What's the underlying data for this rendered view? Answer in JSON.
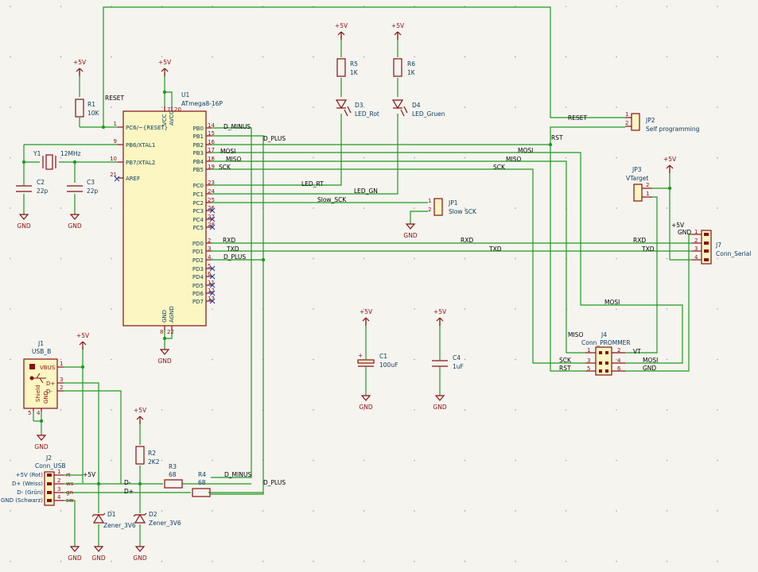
{
  "ic": {
    "ref": "U1",
    "value": "ATmega8-16P",
    "left_pins": [
      {
        "num": "1",
        "name": "PC6/~{RESET}"
      },
      {
        "num": "9",
        "name": "PB6/XTAL1"
      },
      {
        "num": "10",
        "name": "PB7/XTAL2"
      },
      {
        "num": "21",
        "name": "AREF"
      }
    ],
    "top_pins": [
      {
        "num": "7",
        "name": "VCC"
      },
      {
        "num": "20",
        "name": "AVCC"
      }
    ],
    "bottom_pins": [
      {
        "num": "8",
        "name": "GND"
      },
      {
        "num": "22",
        "name": "AGND"
      }
    ],
    "right_pins": [
      {
        "num": "14",
        "name": "PB0"
      },
      {
        "num": "15",
        "name": "PB1"
      },
      {
        "num": "16",
        "name": "PB2"
      },
      {
        "num": "17",
        "name": "PB3"
      },
      {
        "num": "18",
        "name": "PB4"
      },
      {
        "num": "19",
        "name": "PB5"
      },
      {
        "num": "23",
        "name": "PC0"
      },
      {
        "num": "24",
        "name": "PC1"
      },
      {
        "num": "25",
        "name": "PC2"
      },
      {
        "num": "26",
        "name": "PC3"
      },
      {
        "num": "27",
        "name": "PC4"
      },
      {
        "num": "28",
        "name": "PC5"
      },
      {
        "num": "2",
        "name": "PD0"
      },
      {
        "num": "3",
        "name": "PD1"
      },
      {
        "num": "4",
        "name": "PD2"
      },
      {
        "num": "5",
        "name": "PD3"
      },
      {
        "num": "6",
        "name": "PD4"
      },
      {
        "num": "11",
        "name": "PD5"
      },
      {
        "num": "12",
        "name": "PD6"
      },
      {
        "num": "13",
        "name": "PD7"
      }
    ]
  },
  "power": {
    "vcc": "+5V",
    "gnd": "GND"
  },
  "resistors": {
    "r1": {
      "ref": "R1",
      "value": "10K"
    },
    "r5": {
      "ref": "R5",
      "value": "1K"
    },
    "r6": {
      "ref": "R6",
      "value": "1K"
    },
    "r2": {
      "ref": "R2",
      "value": "2K2"
    },
    "r3": {
      "ref": "R3",
      "value": "68"
    },
    "r4": {
      "ref": "R4",
      "value": "68"
    }
  },
  "caps": {
    "c1": {
      "ref": "C1",
      "value": "100uF"
    },
    "c2": {
      "ref": "C2",
      "value": "22p"
    },
    "c3": {
      "ref": "C3",
      "value": "22p"
    },
    "c4": {
      "ref": "C4",
      "value": "1uF"
    }
  },
  "crystal": {
    "ref": "Y1",
    "value": "12MHz"
  },
  "leds": {
    "d3": {
      "ref": "D3",
      "value": "LED_Rot"
    },
    "d4": {
      "ref": "D4",
      "value": "LED_Gruen"
    }
  },
  "zeners": {
    "d1": {
      "ref": "D1",
      "value": "Zener_3V6"
    },
    "d2": {
      "ref": "D2",
      "value": "Zener_3V6"
    }
  },
  "jumpers": {
    "jp1": {
      "ref": "JP1",
      "value": "Slow SCK"
    },
    "jp2": {
      "ref": "JP2",
      "value": "Self programming"
    },
    "jp3": {
      "ref": "JP3",
      "value": "VTarget"
    }
  },
  "connectors": {
    "j1": {
      "ref": "J1",
      "value": "USB_B",
      "pins": [
        "VBUS",
        "D+",
        "D-"
      ],
      "shield": "Shield",
      "gnd": "GND",
      "nums": [
        "1",
        "3",
        "2",
        "5",
        "4"
      ]
    },
    "j2": {
      "ref": "J2",
      "value": "Conn_USB",
      "labels": [
        "+5V (Rot)",
        "D+ (Weiss)",
        "D- (Grün)",
        "GND (Schwarz)"
      ],
      "pin_names": [
        "rt",
        "ws",
        "gn",
        "sw"
      ],
      "nums": [
        "1",
        "2",
        "3",
        "4"
      ]
    },
    "j4": {
      "ref": "J4",
      "value": "Conn_PROMMER",
      "nums": [
        "1",
        "2",
        "3",
        "4",
        "5",
        "6"
      ]
    },
    "j7": {
      "ref": "J7",
      "value": "Conn_Serial",
      "nums": [
        "1",
        "2",
        "3",
        "4"
      ]
    }
  },
  "nets": {
    "reset": "RESET",
    "d_minus": "D_MINUS",
    "d_plus": "D_PLUS",
    "mosi": "MOSI",
    "miso": "MISO",
    "sck": "SCK",
    "led_rt": "LED_RT",
    "led_gn": "LED_GN",
    "slow_sck": "Slow_SCK",
    "rxd": "RXD",
    "txd": "TXD",
    "rst": "RST",
    "vt": "VT",
    "dm": "D-",
    "dp": "D+",
    "plus5v": "+5V",
    "gnd": "GND"
  }
}
